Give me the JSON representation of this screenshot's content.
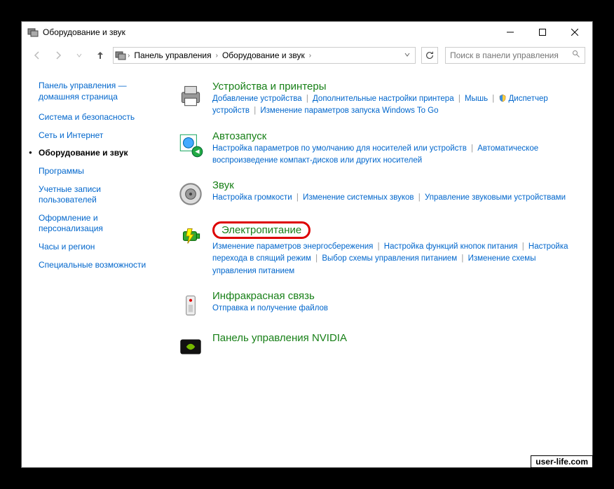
{
  "window": {
    "title": "Оборудование и звук"
  },
  "nav": {
    "breadcrumb": [
      "Панель управления",
      "Оборудование и звук"
    ],
    "search_placeholder": "Поиск в панели управления"
  },
  "sidebar": {
    "home": "Панель управления — домашняя страница",
    "items": [
      {
        "label": "Система и безопасность",
        "active": false
      },
      {
        "label": "Сеть и Интернет",
        "active": false
      },
      {
        "label": "Оборудование и звук",
        "active": true
      },
      {
        "label": "Программы",
        "active": false
      },
      {
        "label": "Учетные записи пользователей",
        "active": false
      },
      {
        "label": "Оформление и персонализация",
        "active": false
      },
      {
        "label": "Часы и регион",
        "active": false
      },
      {
        "label": "Специальные возможности",
        "active": false
      }
    ]
  },
  "categories": [
    {
      "title": "Устройства и принтеры",
      "highlighted": false,
      "icon": "printer",
      "links": [
        {
          "label": "Добавление устройства",
          "shield": false
        },
        {
          "label": "Дополнительные настройки принтера",
          "shield": false
        },
        {
          "label": "Мышь",
          "shield": false
        },
        {
          "label": "Диспетчер устройств",
          "shield": true
        },
        {
          "label": "Изменение параметров запуска Windows To Go",
          "shield": false
        }
      ]
    },
    {
      "title": "Автозапуск",
      "highlighted": false,
      "icon": "autoplay",
      "links": [
        {
          "label": "Настройка параметров по умолчанию для носителей или устройств",
          "shield": false
        },
        {
          "label": "Автоматическое воспроизведение компакт-дисков или других носителей",
          "shield": false
        }
      ]
    },
    {
      "title": "Звук",
      "highlighted": false,
      "icon": "sound",
      "links": [
        {
          "label": "Настройка громкости",
          "shield": false
        },
        {
          "label": "Изменение системных звуков",
          "shield": false
        },
        {
          "label": "Управление звуковыми устройствами",
          "shield": false
        }
      ]
    },
    {
      "title": "Электропитание",
      "highlighted": true,
      "icon": "power",
      "links": [
        {
          "label": "Изменение параметров энергосбережения",
          "shield": false
        },
        {
          "label": "Настройка функций кнопок питания",
          "shield": false
        },
        {
          "label": "Настройка перехода в спящий режим",
          "shield": false
        },
        {
          "label": "Выбор схемы управления питанием",
          "shield": false
        },
        {
          "label": "Изменение схемы управления питанием",
          "shield": false
        }
      ]
    },
    {
      "title": "Инфракрасная связь",
      "highlighted": false,
      "icon": "infrared",
      "links": [
        {
          "label": "Отправка и получение файлов",
          "shield": false
        }
      ]
    },
    {
      "title": "Панель управления NVIDIA",
      "highlighted": false,
      "icon": "nvidia",
      "links": []
    }
  ],
  "watermark": "user-life.com"
}
